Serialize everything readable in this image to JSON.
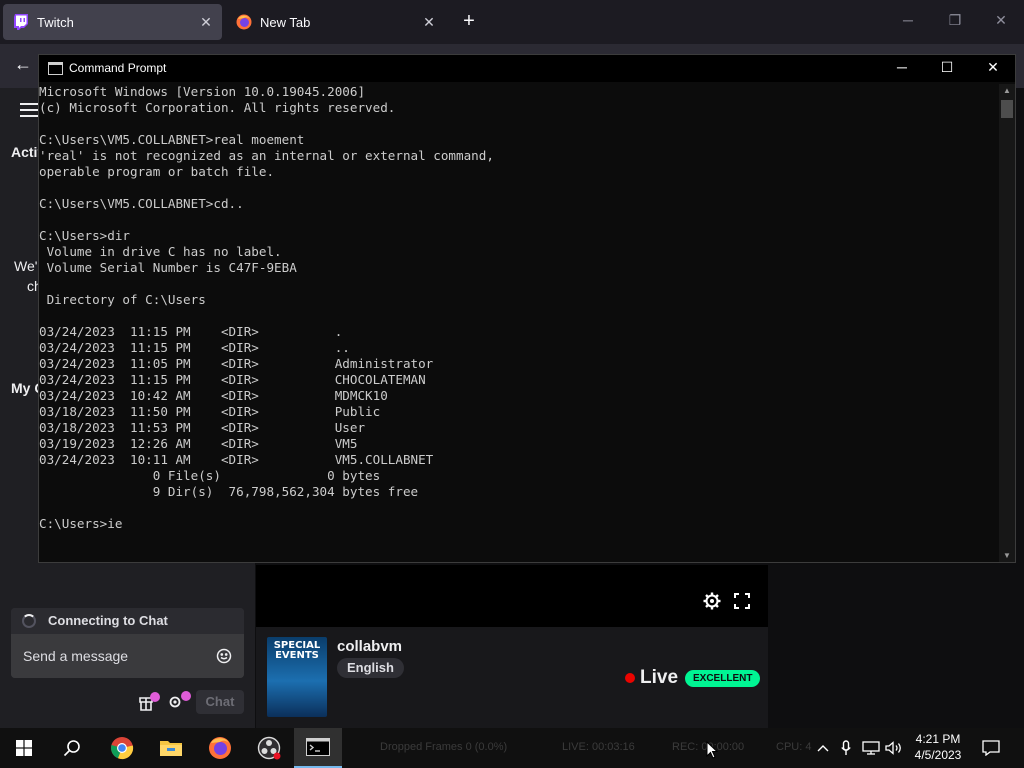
{
  "browser": {
    "tabs": [
      {
        "label": "Twitch",
        "active": true,
        "icon": "twitch-icon"
      },
      {
        "label": "New Tab",
        "active": false,
        "icon": "firefox-icon"
      }
    ],
    "new_tab_symbol": "+"
  },
  "twitch": {
    "sidebar_fragments": {
      "active": "Activ",
      "my": "My C",
      "we": "We'",
      "ch": "ch"
    },
    "stream": {
      "channel": "collabvm",
      "language": "English",
      "status": "Live",
      "quality": "EXCELLENT",
      "thumbnail_text": "SPECIAL EVENTS"
    },
    "chat": {
      "connecting": "Connecting to Chat",
      "placeholder": "Send a message",
      "chat_button": "Chat"
    }
  },
  "cmd": {
    "title": "Command Prompt",
    "lines": [
      "Microsoft Windows [Version 10.0.19045.2006]",
      "(c) Microsoft Corporation. All rights reserved.",
      "",
      "C:\\Users\\VM5.COLLABNET>real moement",
      "'real' is not recognized as an internal or external command,",
      "operable program or batch file.",
      "",
      "C:\\Users\\VM5.COLLABNET>cd..",
      "",
      "C:\\Users>dir",
      " Volume in drive C has no label.",
      " Volume Serial Number is C47F-9EBA",
      "",
      " Directory of C:\\Users",
      "",
      "03/24/2023  11:15 PM    <DIR>          .",
      "03/24/2023  11:15 PM    <DIR>          ..",
      "03/24/2023  11:05 PM    <DIR>          Administrator",
      "03/24/2023  11:15 PM    <DIR>          CHOCOLATEMAN",
      "03/24/2023  10:42 AM    <DIR>          MDMCK10",
      "03/18/2023  11:50 PM    <DIR>          Public",
      "03/18/2023  11:53 PM    <DIR>          User",
      "03/19/2023  12:26 AM    <DIR>          VM5",
      "03/24/2023  10:11 AM    <DIR>          VM5.COLLABNET",
      "               0 File(s)              0 bytes",
      "               9 Dir(s)  76,798,562,304 bytes free",
      "",
      "C:\\Users>ie"
    ]
  },
  "taskbar": {
    "ghost_text": {
      "dropped": "Dropped Frames 0 (0.0%)",
      "live": "LIVE: 00:03:16",
      "rec": "REC: 00:00:00",
      "cpu": "CPU: 4"
    },
    "clock_time": "4:21 PM",
    "clock_date": "4/5/2023"
  }
}
